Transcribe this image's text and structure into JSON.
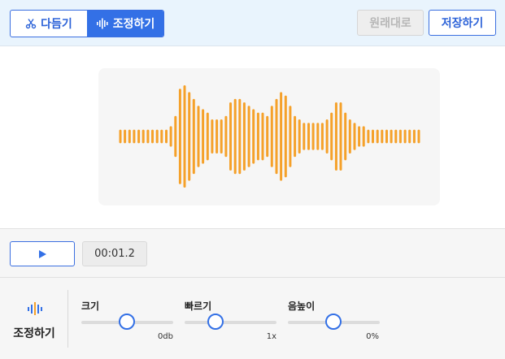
{
  "toolbar": {
    "tabs": [
      {
        "label": "다듬기",
        "icon": "scissors-icon",
        "active": false
      },
      {
        "label": "조정하기",
        "icon": "audio-wave-icon",
        "active": true
      }
    ],
    "reset_label": "원래대로",
    "save_label": "저장하기"
  },
  "waveform": {
    "color": "#f5a12a",
    "amplitudes": [
      4,
      4,
      4,
      4,
      4,
      4,
      4,
      4,
      4,
      4,
      4,
      6,
      12,
      28,
      30,
      26,
      22,
      18,
      16,
      14,
      10,
      10,
      10,
      12,
      20,
      22,
      22,
      20,
      18,
      16,
      14,
      14,
      12,
      18,
      22,
      26,
      24,
      18,
      12,
      10,
      8,
      8,
      8,
      8,
      8,
      10,
      14,
      20,
      20,
      14,
      10,
      8,
      6,
      6,
      4,
      4,
      4,
      4,
      4,
      4,
      4,
      4,
      4,
      4,
      4,
      4
    ]
  },
  "player": {
    "time": "00:01.2",
    "play_icon": "play-icon"
  },
  "panel": {
    "title": "조정하기",
    "icon": "audio-wave-icon",
    "controls": [
      {
        "label": "크기",
        "value_text": "0db",
        "position": 0.5
      },
      {
        "label": "빠르기",
        "value_text": "1x",
        "position": 0.15
      },
      {
        "label": "음높이",
        "value_text": "0%",
        "position": 0.5
      }
    ]
  },
  "colors": {
    "accent": "#3370e6",
    "wave": "#f5a12a",
    "toolbar_bg": "#e9f4fd"
  }
}
